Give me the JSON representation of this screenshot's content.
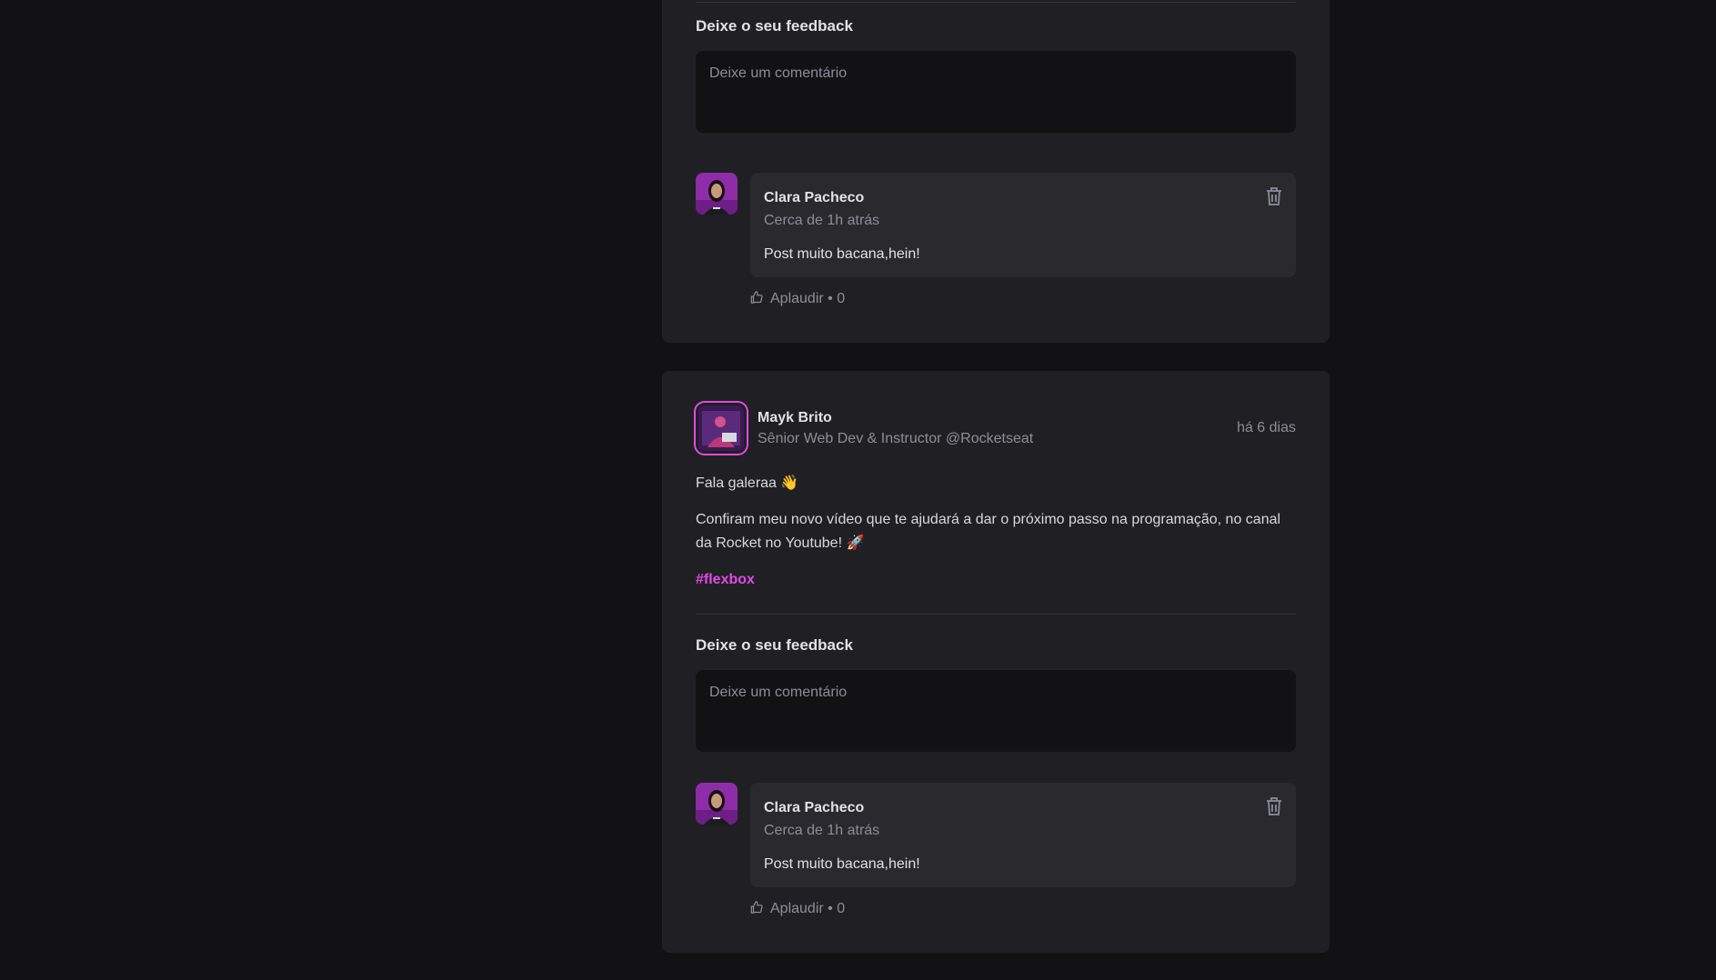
{
  "post1": {
    "feedback_title": "Deixe o seu feedback",
    "comment_placeholder": "Deixe um comentário",
    "comment": {
      "author": "Clara Pacheco",
      "time": "Cerca de 1h atrás",
      "text": "Post muito bacana,hein!",
      "applaud_label": "Aplaudir",
      "separator": "•",
      "applaud_count": "0"
    }
  },
  "post2": {
    "author_name": "Mayk Brito",
    "author_role": "Sênior Web Dev & Instructor @Rocketseat",
    "published": "há 6 dias",
    "paragraph1": "Fala galeraa 👋",
    "paragraph2": "Confiram meu novo vídeo que te ajudará a dar o próximo passo na programação, no canal da Rocket no Youtube! 🚀",
    "hashtag": "#flexbox",
    "feedback_title": "Deixe o seu feedback",
    "comment_placeholder": "Deixe um comentário",
    "comment": {
      "author": "Clara Pacheco",
      "time": "Cerca de 1h atrás",
      "text": "Post muito bacana,hein!",
      "applaud_label": "Aplaudir",
      "separator": "•",
      "applaud_count": "0"
    }
  },
  "icons": {
    "trash": "trash-icon",
    "thumbs_up": "thumbs-up-icon"
  },
  "colors": {
    "background": "#121214",
    "card": "#202024",
    "comment_bubble": "#29292e",
    "accent": "#e24ae6",
    "muted_text": "#8d8d99"
  }
}
